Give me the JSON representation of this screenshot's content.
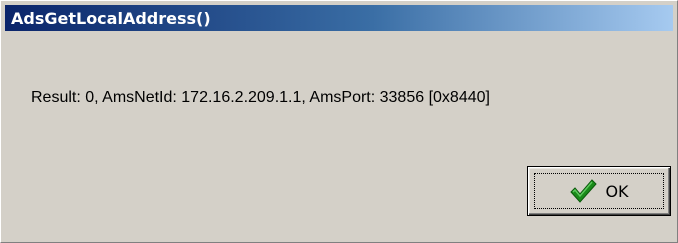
{
  "window": {
    "title": "AdsGetLocalAddress()"
  },
  "message": {
    "text": "Result: 0, AmsNetId: 172.16.2.209.1.1, AmsPort: 33856 [0x8440]"
  },
  "buttons": {
    "ok_label": "OK",
    "ok_icon": "checkmark-icon"
  },
  "colors": {
    "titlebar_start": "#0a246a",
    "titlebar_end": "#a6caf0",
    "dialog_background": "#d4d0c8",
    "checkmark": "#1a8a1a"
  }
}
